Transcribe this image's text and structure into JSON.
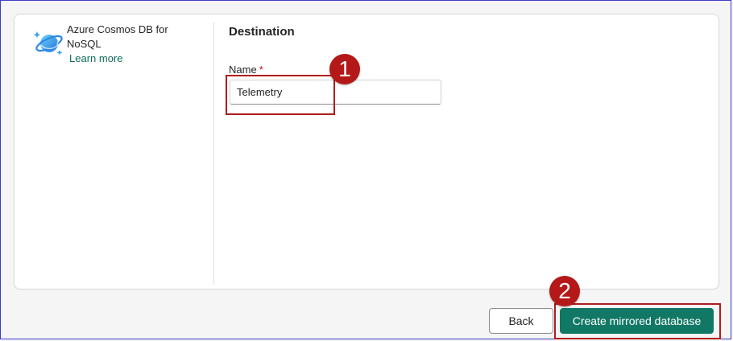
{
  "source": {
    "icon": "cosmos-db-icon",
    "title": "Azure Cosmos DB for NoSQL",
    "learn_more": "Learn more"
  },
  "destination": {
    "section_title": "Destination",
    "name_label": "Name",
    "required_marker": "*",
    "name_value": "Telemetry"
  },
  "annotations": {
    "step1": "1",
    "step2": "2"
  },
  "footer": {
    "back_label": "Back",
    "create_label": "Create mirrored database"
  },
  "colors": {
    "accent": "#117865",
    "link": "#0f6b5a",
    "callout": "#b51818",
    "required": "#c50f1f"
  }
}
